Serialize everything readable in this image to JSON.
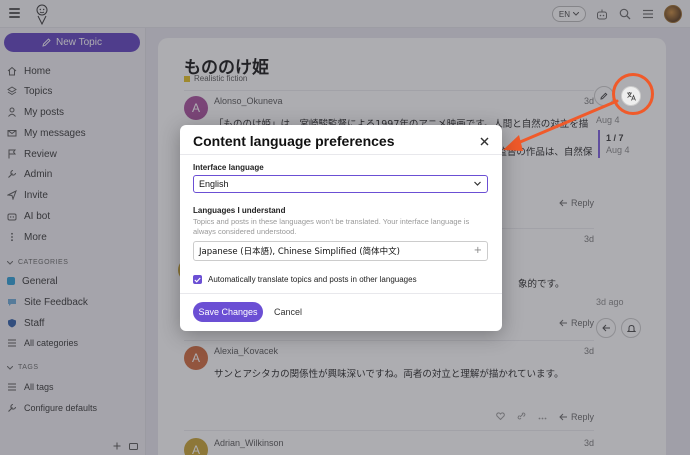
{
  "header": {
    "lang_code": "EN"
  },
  "sidebar": {
    "new_topic_label": "New Topic",
    "items": [
      {
        "label": "Home"
      },
      {
        "label": "Topics"
      },
      {
        "label": "My posts"
      },
      {
        "label": "My messages"
      },
      {
        "label": "Review"
      },
      {
        "label": "Admin"
      },
      {
        "label": "Invite"
      },
      {
        "label": "AI bot"
      },
      {
        "label": "More"
      }
    ],
    "categories_title": "CATEGORIES",
    "categories": [
      {
        "label": "General",
        "color": "#2a9fd8"
      },
      {
        "label": "Site Feedback",
        "color": "#6aa9d8"
      },
      {
        "label": "Staff",
        "color": "#2b5ca8"
      },
      {
        "label": "All categories"
      }
    ],
    "tags_title": "TAGS",
    "tags": [
      {
        "label": "All tags"
      },
      {
        "label": "Configure defaults"
      }
    ]
  },
  "topic": {
    "title": "もののけ姫",
    "category": "Realistic fiction",
    "posts": [
      {
        "user": "Alonso_Okuneva",
        "date": "3d",
        "avatar_letter": "A",
        "avatar_color": "#a84d9c",
        "text": "「もののけ姫」は、宮崎駿監督による1997年のアニメ映画です。人間と自然の対立を描き、主",
        "line2": "人公アシタカの冒険を通して環境問題を考えさせる作品です。宮崎監督の作品は、自然保",
        "line3": "護のメッセージが込められています。サンとアシタカやサ"
      },
      {
        "user": "",
        "date": "3d",
        "text_tail": "象的です。"
      },
      {
        "user": "Alexia_Kovacek",
        "date": "3d",
        "avatar_letter": "A",
        "avatar_color": "#d0683a",
        "text": "サンとアシタカの関係性が興味深いですね。両者の対立と理解が描かれています。"
      },
      {
        "user": "Adrian_Wilkinson",
        "date": "3d",
        "avatar_letter": "A",
        "avatar_color": "#c8a230"
      }
    ],
    "reply_label": "Reply"
  },
  "timeline": {
    "top_date": "Aug 4",
    "position": "1 / 7",
    "position_date": "Aug 4",
    "bottom_date": "3d ago"
  },
  "modal": {
    "title": "Content language preferences",
    "interface_label": "Interface language",
    "interface_value": "English",
    "languages_label": "Languages I understand",
    "languages_help": "Topics and posts in these languages won't be translated. Your interface language is always considered understood.",
    "languages_value": "Japanese (日本語), Chinese Simplified (简体中文)",
    "auto_translate_label": "Automatically translate topics and posts in other languages",
    "save_label": "Save Changes",
    "cancel_label": "Cancel"
  },
  "colors": {
    "accent": "#6b4fd4",
    "annotation": "#f05a2a"
  }
}
